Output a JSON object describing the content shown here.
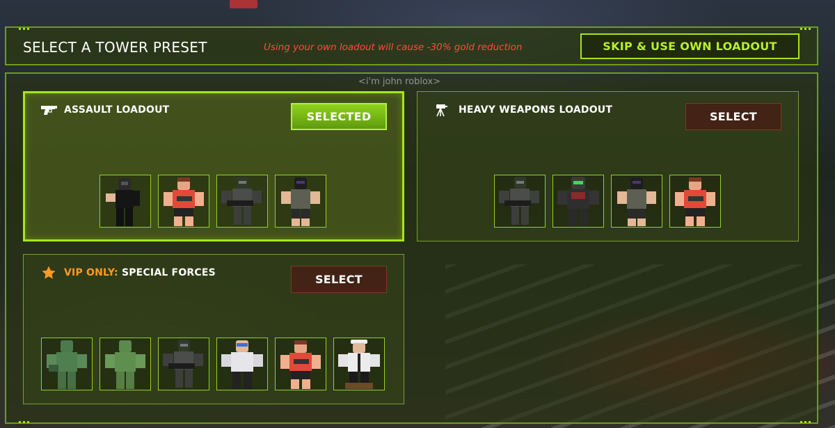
{
  "header": {
    "title": "SELECT A TOWER PRESET",
    "warning": "Using your own loadout will cause -30% gold reduction",
    "skip_label": "SKIP & USE OWN LOADOUT"
  },
  "overhead_tag": "<i'm john roblox>",
  "colors": {
    "accent": "#a6e61a",
    "warning": "#ff4b3a",
    "vip": "#ff9b22",
    "select_button": "#46201a"
  },
  "loadouts": [
    {
      "name": "ASSAULT LOADOUT",
      "icon": "pistol-icon",
      "button_label": "SELECTED",
      "selected": true,
      "towers": [
        "masked-soldier",
        "red-vest-shotgunner",
        "gray-masked-gunner",
        "black-masked-soldier"
      ]
    },
    {
      "name": "HEAVY WEAPONS LOADOUT",
      "icon": "turret-icon",
      "button_label": "SELECT",
      "selected": false,
      "towers": [
        "gray-masked-gunner",
        "green-visor-heavy",
        "black-masked-soldier",
        "red-vest-shotgunner"
      ]
    },
    {
      "vip_prefix": "VIP ONLY:",
      "name": "SPECIAL FORCES",
      "icon": "star-icon",
      "button_label": "SELECT",
      "selected": false,
      "towers": [
        "green-camo-soldier",
        "green-camo-sniper",
        "gray-masked-gunner",
        "blue-visor-agent",
        "red-vest-shotgunner",
        "police-officer"
      ]
    }
  ]
}
